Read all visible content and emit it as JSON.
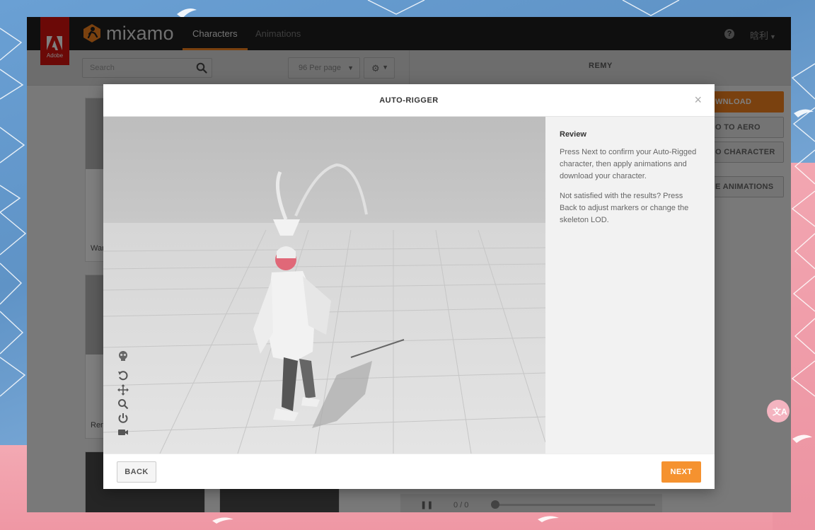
{
  "app": {
    "adobe_label": "Adobe",
    "brand_name": "mixamo",
    "nav_tabs": [
      {
        "label": "Characters",
        "active": true
      },
      {
        "label": "Animations",
        "active": false
      }
    ],
    "help_icon": "question-circle-icon",
    "user_name": "晗利",
    "accent_color": "#f5821f"
  },
  "toolbar": {
    "search_placeholder": "Search",
    "per_page_label": "96 Per page",
    "character_title": "REMY"
  },
  "background": {
    "cards": [
      {
        "name": "War"
      },
      {
        "name": "Ren"
      }
    ],
    "right_buttons": [
      {
        "label": "WNLOAD"
      },
      {
        "label": "O TO AERO"
      },
      {
        "label": "O CHARACTER"
      },
      {
        "label": "E ANIMATIONS"
      }
    ],
    "timeline_counter": "0 / 0"
  },
  "modal": {
    "title": "AUTO-RIGGER",
    "close_symbol": "×",
    "review_heading": "Review",
    "paragraphs": [
      "Press Next to confirm your Auto-Rigged character, then apply animations and download your character.",
      "Not satisfied with the results? Press Back to adjust markers or change the skeleton LOD."
    ],
    "back_label": "BACK",
    "next_label": "NEXT",
    "viewport_tools": [
      "skeleton-icon",
      "rotate-icon",
      "move-icon",
      "zoom-icon",
      "power-icon",
      "camera-icon"
    ]
  },
  "translate_badge": "文A"
}
